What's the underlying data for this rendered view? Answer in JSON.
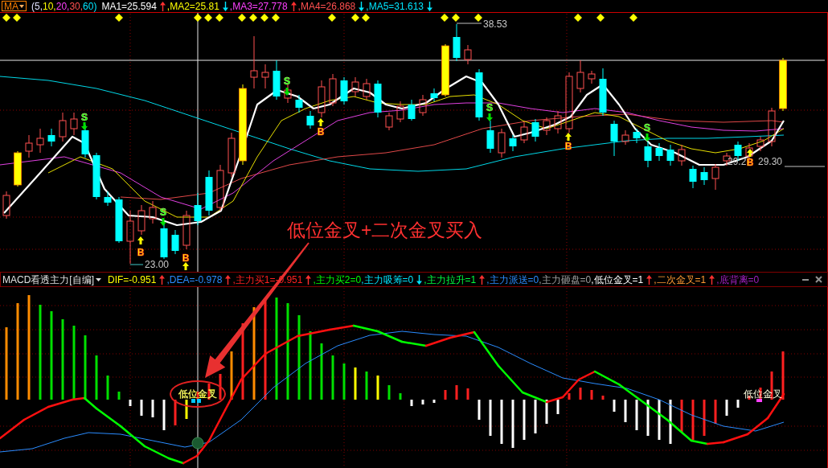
{
  "ma_header": {
    "menu": "MA",
    "period_parts": [
      {
        "text": "(5,",
        "color": "#e0e0ff"
      },
      {
        "text": "10,",
        "color": "#ffff00"
      },
      {
        "text": "20,",
        "color": "#ff40ff"
      },
      {
        "text": "30,",
        "color": "#ff5050"
      },
      {
        "text": "60)",
        "color": "#00e5ff"
      }
    ],
    "readings": [
      {
        "text": "MA1=25.594",
        "color": "#ffffff",
        "kind": "up"
      },
      {
        "text": ",MA2=25.81",
        "color": "#ffff00",
        "kind": "down"
      },
      {
        "text": ",MA3=27.778",
        "color": "#ff40ff",
        "kind": "up"
      },
      {
        "text": ",MA4=26.868",
        "color": "#ff5050",
        "kind": "down"
      },
      {
        "text": ",MA5=31.613",
        "color": "#00e5ff",
        "kind": "down"
      }
    ]
  },
  "price_chart": {
    "signals": [
      {
        "kind": "sell",
        "label": "S"
      },
      {
        "kind": "buy",
        "label": "B"
      },
      {
        "kind": "sell",
        "label": "S"
      },
      {
        "kind": "buy",
        "label": "B"
      },
      {
        "kind": "sell",
        "label": "S"
      },
      {
        "kind": "buy",
        "label": "B"
      },
      {
        "kind": "sell",
        "label": "S"
      },
      {
        "kind": "buy",
        "label": "B"
      },
      {
        "kind": "sell",
        "label": "S"
      },
      {
        "kind": "buy",
        "label": "B"
      }
    ],
    "price_labels": [
      "38.53",
      "23.00",
      "29.2",
      "29.30"
    ],
    "annotation": "低位金叉+二次金叉买入"
  },
  "macd_header": {
    "menu": "MACD看透主力[自编]",
    "readings": [
      {
        "text": "DIF=-0.951",
        "color": "#ffff00",
        "kind": "up"
      },
      {
        "text": ",DEA=-0.978",
        "color": "#2a8cff",
        "kind": "up"
      },
      {
        "text": ",主力买1=-0.951",
        "color": "#ff2020",
        "kind": "up"
      },
      {
        "text": ",主力买2=0",
        "color": "#00ff00",
        "kind": "plain"
      },
      {
        "text": ",主力吸筹=0",
        "color": "#00e5ff",
        "kind": "down"
      },
      {
        "text": ",主力拉升=1",
        "color": "#00ff40",
        "kind": "up"
      },
      {
        "text": ",主力派送=0",
        "color": "#2a8cff",
        "kind": "plain"
      },
      {
        "text": ",主力砸盘=0",
        "color": "#a0a0a0",
        "kind": "plain"
      },
      {
        "text": ",低位金叉=1",
        "color": "#ffffff",
        "kind": "up"
      },
      {
        "text": ",二次金叉=1",
        "color": "#ff9933",
        "kind": "up"
      },
      {
        "text": ",底背离=0",
        "color": "#a020c0",
        "kind": "plain"
      }
    ]
  },
  "macd_chart": {
    "labels": [
      "低位金叉",
      "低位金叉"
    ]
  }
}
